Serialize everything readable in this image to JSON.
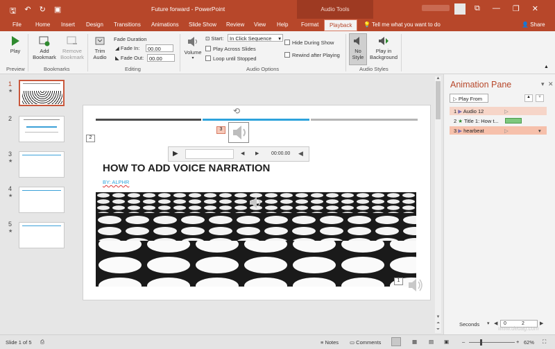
{
  "window": {
    "title": "Future forward - PowerPoint",
    "context_tools": "Audio Tools",
    "controls": {
      "minimize": "—",
      "restore": "❐",
      "close": "✕"
    }
  },
  "quick_access": {
    "save": "🖫",
    "undo": "↶",
    "redo": "↻",
    "present": "▣"
  },
  "tabs": [
    "File",
    "Home",
    "Insert",
    "Design",
    "Transitions",
    "Animations",
    "Slide Show",
    "Review",
    "View",
    "Help",
    "Format",
    "Playback"
  ],
  "active_tab": "Playback",
  "tell_me": "Tell me what you want to do",
  "share": "Share",
  "ribbon": {
    "preview": {
      "play": "Play",
      "group": "Preview"
    },
    "bookmarks": {
      "add": "Add Bookmark",
      "remove": "Remove Bookmark",
      "group": "Bookmarks"
    },
    "editing": {
      "trim": "Trim Audio",
      "fade_duration": "Fade Duration",
      "fade_in_label": "Fade In:",
      "fade_in_value": "00.00",
      "fade_out_label": "Fade Out:",
      "fade_out_value": "00.00",
      "group": "Editing"
    },
    "audio_options": {
      "volume": "Volume",
      "start_label": "Start:",
      "start_value": "In Click Sequence",
      "play_across": "Play Across Slides",
      "loop": "Loop until Stopped",
      "hide": "Hide During Show",
      "rewind": "Rewind after Playing",
      "group": "Audio Options"
    },
    "audio_styles": {
      "no_style": "No Style",
      "play_bg": "Play in Background",
      "group": "Audio Styles"
    }
  },
  "thumbnails": [
    {
      "num": "1",
      "star": "★"
    },
    {
      "num": "2",
      "star": ""
    },
    {
      "num": "3",
      "star": "★"
    },
    {
      "num": "4",
      "star": "★"
    },
    {
      "num": "5",
      "star": "★"
    }
  ],
  "slide": {
    "title": "HOW TO ADD VOICE NARRATION",
    "subtitle": "BY: ALPHR",
    "anim_tag_2": "2",
    "anim_tag_3": "3",
    "anim_tag_1": "1",
    "player_time": "00:00.00"
  },
  "animation_pane": {
    "title": "Animation Pane",
    "play_from": "Play From",
    "items": [
      {
        "num": "1",
        "name": "Audio 12"
      },
      {
        "num": "2",
        "name": "Title 1: How t..."
      },
      {
        "num": "3",
        "name": "hearbeat"
      }
    ],
    "seconds": "Seconds",
    "zoom_start": "0",
    "zoom_end": "2"
  },
  "status": {
    "slide_info": "Slide 1 of 5",
    "notes": "Notes",
    "comments": "Comments",
    "zoom": "62%"
  },
  "watermark": "www.deuag.com",
  "colors": {
    "accent": "#b7472a",
    "highlight": "#f6d5c8"
  }
}
